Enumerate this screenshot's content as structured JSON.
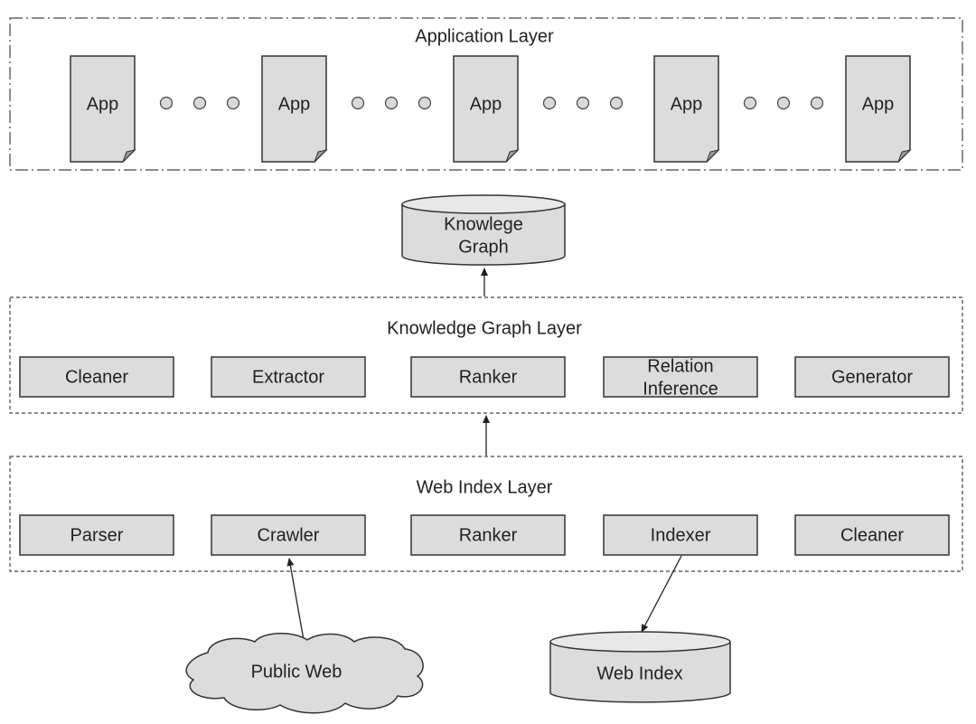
{
  "application_layer": {
    "title": "Application Layer",
    "apps": [
      "App",
      "App",
      "App",
      "App",
      "App"
    ]
  },
  "knowledge_graph_store": {
    "line1": "Knowlege",
    "line2": "Graph"
  },
  "knowledge_graph_layer": {
    "title": "Knowledge Graph Layer",
    "components": [
      "Cleaner",
      "Extractor",
      "Ranker",
      "Relation",
      "Generator"
    ],
    "relation_line2": "Inference"
  },
  "web_index_layer": {
    "title": "Web Index Layer",
    "components": [
      "Parser",
      "Crawler",
      "Ranker",
      "Indexer",
      "Cleaner"
    ]
  },
  "public_web": "Public Web",
  "web_index_store": "Web Index",
  "colors": {
    "fill": "#dcdcdc",
    "stroke": "#333333"
  }
}
